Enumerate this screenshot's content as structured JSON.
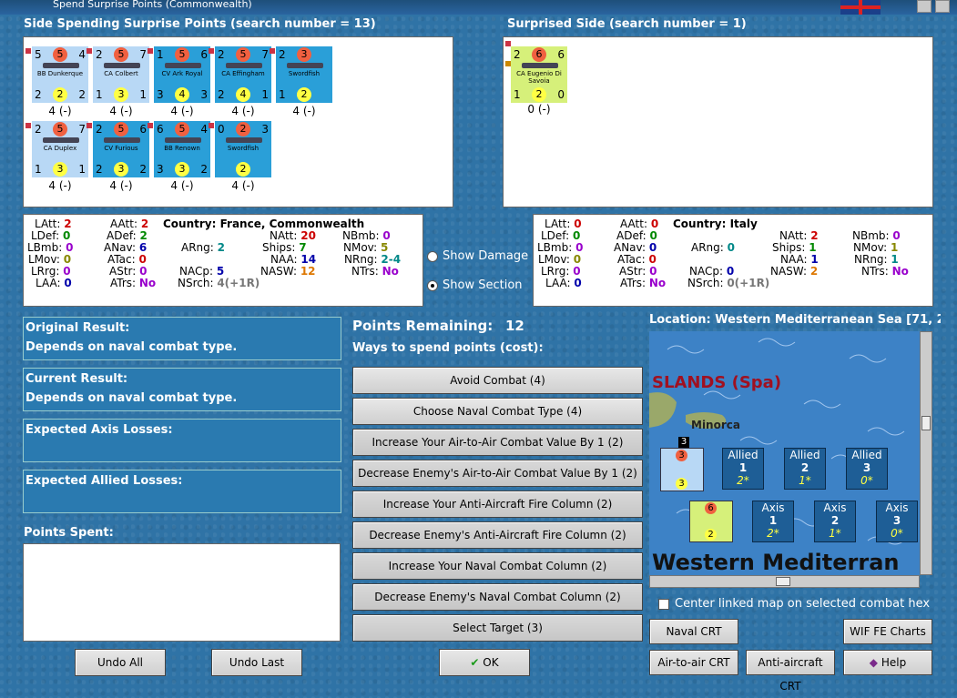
{
  "window": {
    "title": "Spend Surprise Points (Commonwealth)"
  },
  "left_side": {
    "heading": "Side Spending Surprise Points (search number = 13)",
    "counters": [
      {
        "tl": "5",
        "tc": "5",
        "tr": "4",
        "name": "BB Dunkerque",
        "bl": "2",
        "bc": "2",
        "br": "2",
        "under": "4 (-)",
        "color": "#b8d8f5"
      },
      {
        "tl": "2",
        "tc": "5",
        "tr": "7",
        "name": "CA Colbert",
        "bl": "1",
        "bc": "3",
        "br": "1",
        "under": "4 (-)",
        "color": "#b8d8f5"
      },
      {
        "tl": "1",
        "tc": "5",
        "tr": "6",
        "name": "CV Ark Royal",
        "bl": "3",
        "bc": "4",
        "br": "3",
        "under": "4 (-)",
        "color": "#2a9fd8"
      },
      {
        "tl": "2",
        "tc": "5",
        "tr": "7",
        "name": "CA Effingham",
        "bl": "2",
        "bc": "4",
        "br": "1",
        "under": "4 (-)",
        "color": "#2a9fd8"
      },
      {
        "tl": "2",
        "tc": "3",
        "tr": "",
        "name": "Swordfish",
        "bl": "1",
        "bc": "2",
        "br": "",
        "under": "4 (-)",
        "color": "#2a9fd8"
      },
      {
        "tl": "2",
        "tc": "5",
        "tr": "7",
        "name": "CA Duplex",
        "bl": "1",
        "bc": "3",
        "br": "1",
        "under": "4 (-)",
        "color": "#b8d8f5"
      },
      {
        "tl": "2",
        "tc": "5",
        "tr": "6",
        "name": "CV Furious",
        "bl": "2",
        "bc": "3",
        "br": "2",
        "under": "4 (-)",
        "color": "#2a9fd8"
      },
      {
        "tl": "6",
        "tc": "5",
        "tr": "4",
        "name": "BB Renown",
        "bl": "3",
        "bc": "3",
        "br": "2",
        "under": "4 (-)",
        "color": "#2a9fd8"
      },
      {
        "tl": "0",
        "tc": "2",
        "tr": "3",
        "name": "Swordfish",
        "bl": "",
        "bc": "2",
        "br": "",
        "under": "4 (-)",
        "color": "#2a9fd8"
      }
    ],
    "stats": {
      "country": "Country: France, Commonwealth",
      "LAtt": "2",
      "LDef": "0",
      "LBmb": "0",
      "LMov": "0",
      "LRrg": "0",
      "LAA": "0",
      "AAtt": "2",
      "ADef": "2",
      "ANav": "6",
      "ATac": "0",
      "AStr": "0",
      "ATrs": "No",
      "ARng": "2",
      "NACp": "5",
      "NSrch": "4(+1R)",
      "NAtt": "20",
      "Ships": "7",
      "NAA": "14",
      "NASW": "12",
      "NBmb": "0",
      "NMov": "5",
      "NRng": "2-4",
      "NTrs": "No"
    }
  },
  "right_side": {
    "heading": "Surprised Side (search number = 1)",
    "counter": {
      "tl": "2",
      "tc": "6",
      "tr": "6",
      "name": "CA Eugenio Di Savoia",
      "bl": "1",
      "bc": "2",
      "br": "0",
      "under": "0 (-)"
    },
    "stats": {
      "country": "Country: Italy",
      "LAtt": "0",
      "LDef": "0",
      "LBmb": "0",
      "LMov": "0",
      "LRrg": "0",
      "LAA": "0",
      "AAtt": "0",
      "ADef": "0",
      "ANav": "0",
      "ATac": "0",
      "AStr": "0",
      "ATrs": "No",
      "ARng": "0",
      "NACp": "0",
      "NSrch": "0(+1R)",
      "NAtt": "2",
      "Ships": "1",
      "NAA": "1",
      "NASW": "2",
      "NBmb": "0",
      "NMov": "1",
      "NRng": "1",
      "NTrs": "No"
    }
  },
  "toggles": {
    "show_damage": "Show Damage",
    "show_section": "Show Section"
  },
  "results": {
    "original_label": "Original Result:",
    "original_value": "Depends on naval combat type.",
    "current_label": "Current Result:",
    "current_value": "Depends on naval combat type.",
    "axis_losses_label": "Expected Axis Losses:",
    "allied_losses_label": "Expected Allied Losses:",
    "points_spent_label": "Points Spent:"
  },
  "spend": {
    "points_remaining_label": "Points Remaining:",
    "points_remaining_value": "12",
    "ways_label": "Ways to spend points (cost):",
    "options": [
      "Avoid Combat (4)",
      "Choose Naval Combat Type (4)",
      "Increase Your Air-to-Air Combat Value By 1 (2)",
      "Decrease Enemy's Air-to-Air Combat Value By 1 (2)",
      "Increase Your Anti-Aircraft Fire Column (2)",
      "Decrease Enemy's Anti-Aircraft Fire Column (2)",
      "Increase Your Naval Combat Column (2)",
      "Decrease Enemy's Naval Combat Column (2)",
      "Select Target (3)"
    ]
  },
  "buttons": {
    "undo_all": "Undo All",
    "undo_last": "Undo Last",
    "ok": "OK",
    "naval_crt": "Naval CRT",
    "wif_fe_charts": "WIF FE Charts",
    "air_to_air_crt": "Air-to-air CRT",
    "anti_aircraft_crt": "Anti-aircraft CRT",
    "help": "Help"
  },
  "map": {
    "location": "Location: Western Mediterranean Sea [71, 2",
    "islands_label": "SLANDS (Spa)",
    "minorca_label": "Minorca",
    "sea_label": "Western Mediterran",
    "allied_boxes": [
      {
        "label": "Allied",
        "num": "1",
        "val": "2*"
      },
      {
        "label": "Allied",
        "num": "2",
        "val": "1*"
      },
      {
        "label": "Allied",
        "num": "3",
        "val": "0*"
      }
    ],
    "axis_boxes": [
      {
        "label": "Axis",
        "num": "1",
        "val": "2*"
      },
      {
        "label": "Axis",
        "num": "2",
        "val": "1*"
      },
      {
        "label": "Axis",
        "num": "3",
        "val": "0*"
      }
    ],
    "stack_count": "3",
    "center_linked": "Center linked map on selected combat hex"
  },
  "colors": {
    "background": "#2f73a6",
    "counter_light": "#b8d8f5",
    "counter_dark": "#2a9fd8",
    "italy": "#d6f07a"
  }
}
